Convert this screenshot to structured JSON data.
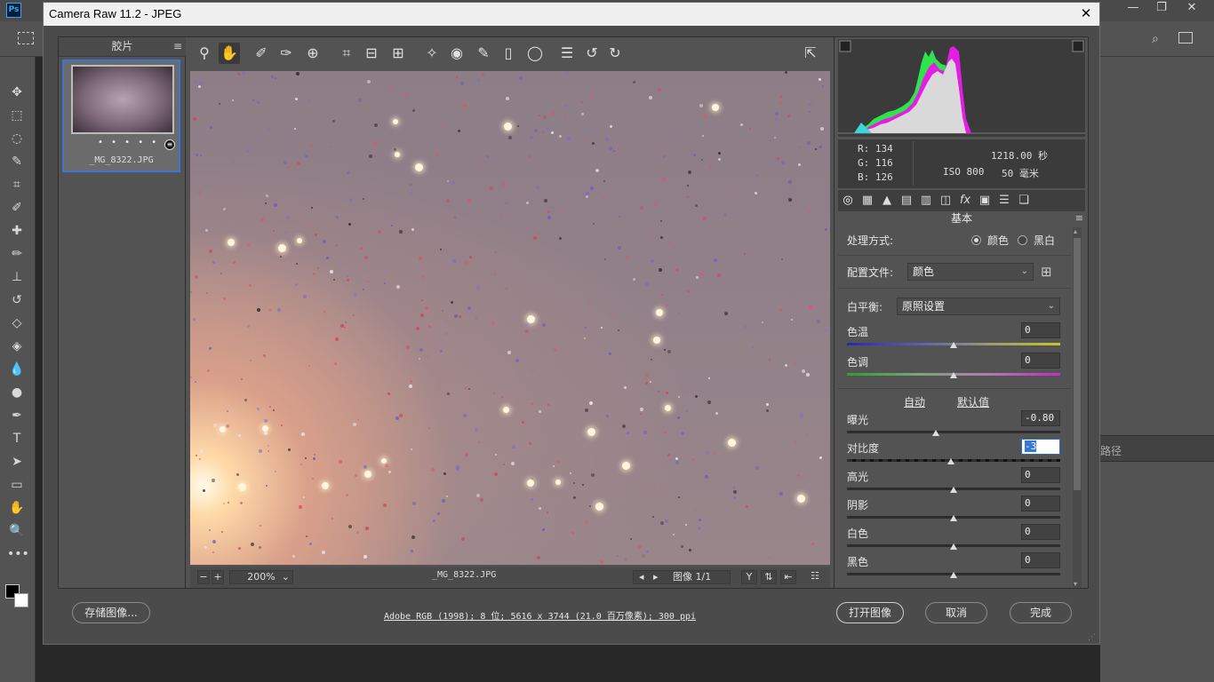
{
  "photoshop": {
    "logo": "Ps",
    "right_panel_tab": "路径"
  },
  "dialog": {
    "title": "Camera Raw 11.2 -  JPEG",
    "close_glyph": "✕"
  },
  "filmstrip": {
    "header": "胶片",
    "items": [
      {
        "name": "_MG_8322.JPG",
        "rating_dots": "• • • • •"
      }
    ]
  },
  "toolbar": {
    "tools": [
      "zoom-tool",
      "hand-tool",
      "white-balance-tool",
      "color-sampler-tool",
      "targeted-adjustment-tool",
      "crop-tool",
      "straighten-tool",
      "transform-tool",
      "spot-removal-tool",
      "red-eye-tool",
      "adjustment-brush",
      "graduated-filter",
      "radial-filter",
      "preferences",
      "rotate-ccw",
      "rotate-cw"
    ],
    "active_tool": "hand-tool"
  },
  "statusbar": {
    "zoom": "200%",
    "filename": "_MG_8322.JPG",
    "image_counter": "图像 1/1"
  },
  "readout": {
    "r_label": "R:",
    "r_value": "134",
    "g_label": "G:",
    "g_value": "116",
    "b_label": "B:",
    "b_value": "126",
    "shutter": "1218.00 秒",
    "iso": "ISO 800",
    "focal": "50 毫米"
  },
  "panel": {
    "title": "基本",
    "treatment_label": "处理方式:",
    "treatment_color": "颜色",
    "treatment_bw": "黑白",
    "treatment_selected": "颜色",
    "profile_label": "配置文件:",
    "profile_value": "颜色",
    "wb_label": "白平衡:",
    "wb_value": "原照设置",
    "auto_label": "自动",
    "default_label": "默认值",
    "sliders": [
      {
        "name": "temperature",
        "label": "色温",
        "value": "0"
      },
      {
        "name": "tint",
        "label": "色调",
        "value": "0"
      },
      {
        "name": "exposure",
        "label": "曝光",
        "value": "-0.80"
      },
      {
        "name": "contrast",
        "label": "对比度",
        "value": "-3"
      },
      {
        "name": "highlights",
        "label": "高光",
        "value": "0"
      },
      {
        "name": "shadows",
        "label": "阴影",
        "value": "0"
      },
      {
        "name": "whites",
        "label": "白色",
        "value": "0"
      },
      {
        "name": "blacks",
        "label": "黑色",
        "value": "0"
      }
    ]
  },
  "footer": {
    "save_button": "存储图像...",
    "workflow_info": "Adobe RGB (1998); 8 位; 5616 x 3744 (21.0 百万像素); 300 ppi",
    "open_button": "打开图像",
    "cancel_button": "取消",
    "done_button": "完成"
  },
  "colors": {
    "selection_border": "#3c77d6",
    "dialog_bg": "#4b4b4b",
    "panel_bg": "#535353"
  }
}
